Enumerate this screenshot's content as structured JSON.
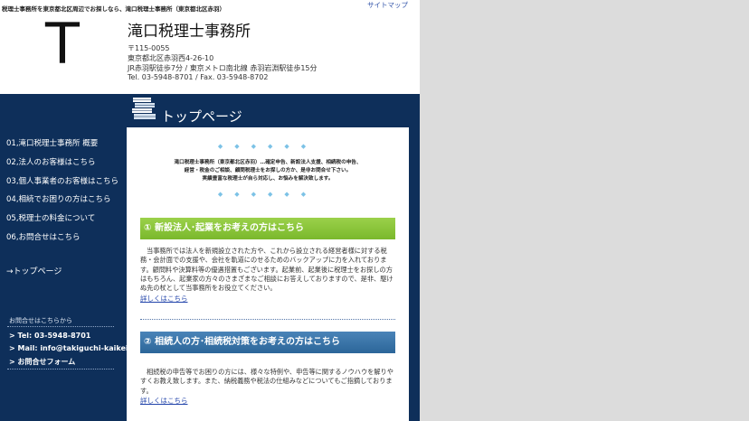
{
  "header": {
    "tagline": "税理士事務所を東京都北区周辺でお探しなら、滝口税理士事務所（東京都北区赤羽）",
    "sitemap_label": "サイトマップ",
    "logo_letter": "T",
    "office_name": "滝口税理士事務所",
    "postal": "〒115-0055",
    "address": "東京都北区赤羽西4-26-10",
    "access": "JR赤羽駅徒歩7分 / 東京メトロ南北線 赤羽岩淵駅徒歩15分",
    "phone_fax": "Tel. 03-5948-8701 / Fax. 03-5948-8702"
  },
  "page_heading": "トップページ",
  "sidebar": {
    "items": [
      {
        "label": "01,滝口税理士事務所 概要"
      },
      {
        "label": "02,法人のお客様はこちら"
      },
      {
        "label": "03,個人事業者のお客様はこちら"
      },
      {
        "label": "04,相続でお困りの方はこちら"
      },
      {
        "label": "05,税理士の料金について"
      },
      {
        "label": "06,お問合せはこちら"
      }
    ],
    "top_link": "→トップページ",
    "contact": {
      "title": "お問合せはこちらから",
      "tel": "> Tel: 03-5948-8701",
      "mail": "> Mail: info@takiguchi-kaikei.jp",
      "form": "> お問合せフォーム"
    }
  },
  "content": {
    "dots_top": "◆◆◆◆◆◆",
    "dots_bottom": "◆◆◆◆◆◆",
    "intro_lines": [
      "滝口税理士事務所（東京都北区赤羽）…確定申告、新設法人支援、相続税の申告、",
      "経営・税金のご相談、顧問税理士をお探しの方か、是非お問合せ下さい。",
      "実績豊富な税理士が自ら対応し、お悩みを解決致します。"
    ],
    "section1": {
      "title": "① 新設法人･起業をお考えの方はこちら",
      "text": "当事務所では法人を新規設立された方や、これから設立される経営者様に対する税務・会計面での支援や、会社を軌道にのせるためのバックアップに力を入れております。顧問料や決算料等の優遇措置もございます。起業前、起業後に税理士をお探しの方はもちろん、起業家の方々のさまざまなご相談にお答えしておりますので、是非、駆けぬ先の杖として当事務所をお役立てください。",
      "link": "詳しくはこちら"
    },
    "section2": {
      "title": "② 相続人の方･相続税対策をお考えの方はこちら",
      "text": "相続税の申告等でお困りの方には、様々な特例や、申告等に関するノウハウを解りやすくお教え致します。また、納税義務や税法の仕組みなどについてもご指摘しております。",
      "link": "詳しくはこちら"
    }
  },
  "colors": {
    "navy": "#0e2f5a",
    "green_bar": "#8cc63f",
    "blue_bar": "#336fa3",
    "dot_accent": "#7cc2e6"
  }
}
